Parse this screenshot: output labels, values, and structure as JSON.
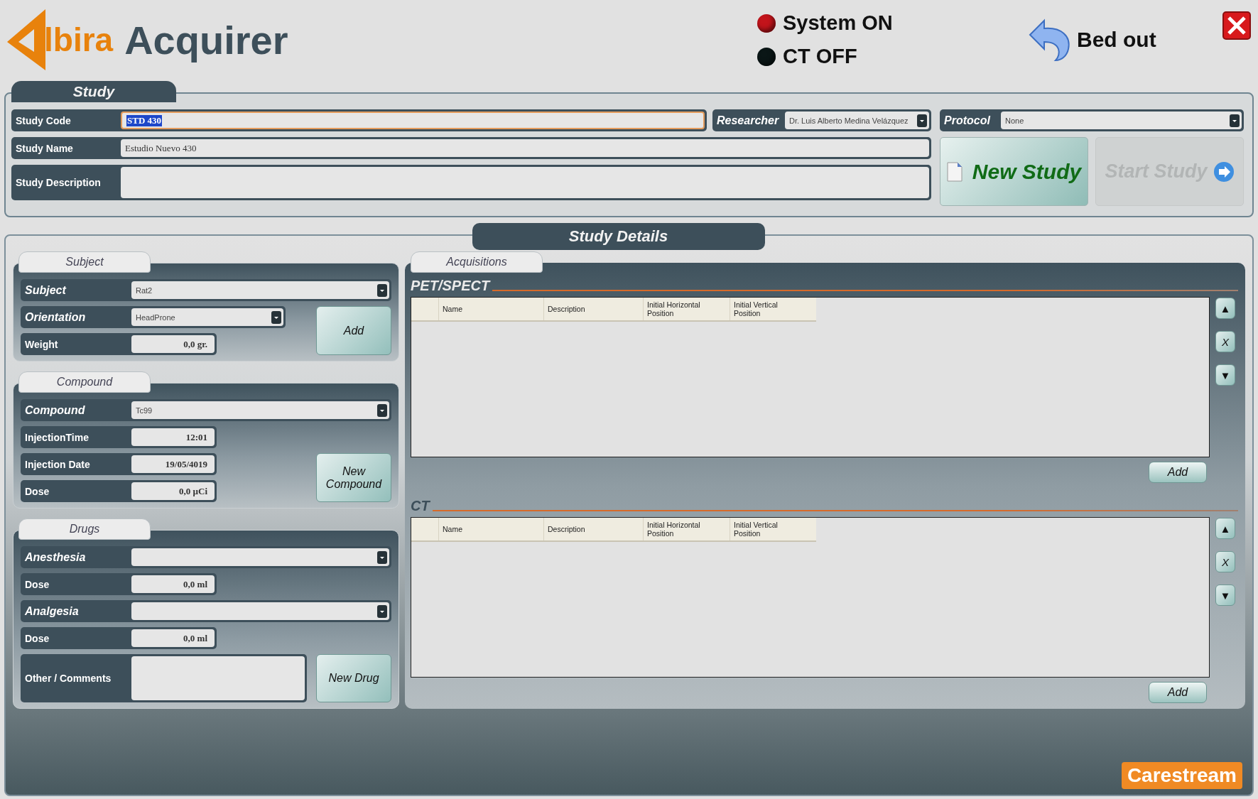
{
  "header": {
    "logo_text": "lbira",
    "product": "Acquirer",
    "status": [
      {
        "label": "System ON",
        "color": "#c3141b"
      },
      {
        "label": "CT OFF",
        "color": "#0a1616"
      }
    ],
    "bed_button": "Bed out"
  },
  "study": {
    "title": "Study",
    "study_code": {
      "label": "Study Code",
      "kind": "text",
      "value": "STD 430",
      "focused": true
    },
    "researcher": {
      "label": "Researcher",
      "kind": "dropdown",
      "value": "Dr. Luis Alberto Medina Velázquez"
    },
    "protocol": {
      "label": "Protocol",
      "kind": "dropdown",
      "value": "None"
    },
    "study_name": {
      "label": "Study Name",
      "kind": "text",
      "value": "Estudio Nuevo 430",
      "focused": false
    },
    "study_description": {
      "label": "Study Description",
      "kind": "area"
    },
    "buttons": [
      {
        "label": "New Study",
        "kind": "new",
        "disabled": false
      },
      {
        "label": "Start Study",
        "kind": "start",
        "disabled": true
      }
    ]
  },
  "details": {
    "title": "Study Details",
    "groups": [
      {
        "title": "Subject",
        "button": "Add",
        "rows": [
          {
            "label": "Subject",
            "kind": "dropdown",
            "value": "Rat2"
          },
          {
            "label": "Orientation",
            "kind": "dropdown",
            "value": "HeadProne"
          },
          {
            "label": "Weight",
            "kind": "number",
            "value": "0,0 gr."
          }
        ]
      },
      {
        "title": "Compound",
        "button": "New Compound",
        "rows": [
          {
            "label": "Compound",
            "kind": "dropdown",
            "value": "Tc99"
          },
          {
            "label": "InjectionTime",
            "kind": "number",
            "value": "12:01"
          },
          {
            "label": "Injection Date",
            "kind": "number",
            "value": "19/05/4019"
          },
          {
            "label": "Dose",
            "kind": "number",
            "value": "0,0 µCi"
          }
        ]
      },
      {
        "title": "Drugs",
        "button": "New Drug",
        "rows": [
          {
            "label": "Anesthesia",
            "kind": "dropdown"
          },
          {
            "label": "Dose",
            "kind": "number",
            "value": "0,0 ml"
          },
          {
            "label": "Analgesia",
            "kind": "dropdown"
          },
          {
            "label": "Dose",
            "kind": "number",
            "value": "0,0 ml"
          },
          {
            "label": "Other / Comments",
            "kind": "area"
          }
        ]
      }
    ],
    "acquisitions": {
      "title": "Acquisitions",
      "tables": [
        {
          "title": "PET/SPECT",
          "columns": [
            "Name",
            "Description",
            "Initial Horizontal Position",
            "Initial Vertical Position"
          ],
          "side_buttons": [
            "▲",
            "X",
            "▼"
          ],
          "add_button": "Add"
        },
        {
          "title": "CT",
          "columns": [
            "Name",
            "Description",
            "Initial Horizontal Position",
            "Initial Vertical Position"
          ],
          "side_buttons": [
            "▲",
            "X",
            "▼"
          ],
          "add_button": "Add"
        }
      ]
    },
    "brand": "Carestream"
  }
}
